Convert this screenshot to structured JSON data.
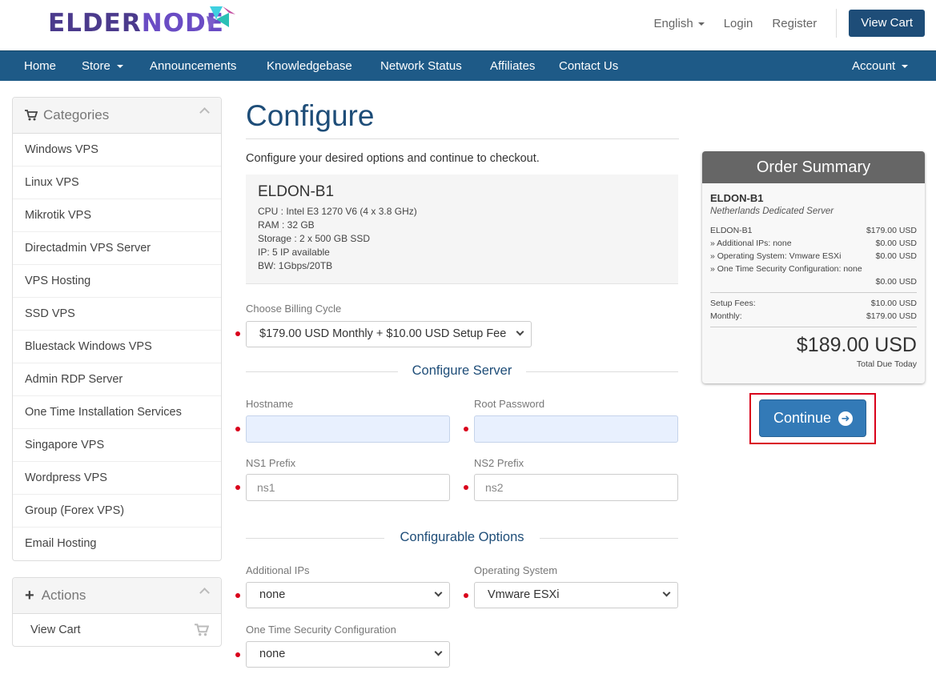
{
  "brand": {
    "logo_text_a": "ELDER",
    "logo_text_b": "NODE"
  },
  "header": {
    "language": "English",
    "login": "Login",
    "register": "Register",
    "view_cart": "View Cart"
  },
  "nav": {
    "home": "Home",
    "store": "Store",
    "announcements": "Announcements",
    "knowledgebase": "Knowledgebase",
    "network_status": "Network Status",
    "affiliates": "Affiliates",
    "contact_us": "Contact Us",
    "account": "Account"
  },
  "sidebar": {
    "categories_title": "Categories",
    "categories": [
      "Windows VPS",
      "Linux VPS",
      "Mikrotik VPS",
      "Directadmin VPS Server",
      "VPS Hosting",
      "SSD VPS",
      "Bluestack Windows VPS",
      "Admin RDP Server",
      "One Time Installation Services",
      "Singapore VPS",
      "Wordpress VPS",
      "Group (Forex VPS)",
      "Email Hosting"
    ],
    "actions_title": "Actions",
    "actions": [
      "View Cart"
    ]
  },
  "main": {
    "title": "Configure",
    "intro": "Configure your desired options and continue to checkout.",
    "product": {
      "name": "ELDON-B1",
      "lines": [
        "CPU : Intel E3 1270 V6 (4 x 3.8 GHz)",
        "RAM : 32 GB",
        "Storage : 2 x 500 GB SSD",
        "IP: 5 IP available",
        "BW: 1Gbps/20TB"
      ]
    },
    "billing_cycle_label": "Choose Billing Cycle",
    "billing_cycle_value": "$179.00 USD Monthly + $10.00 USD Setup Fee",
    "configure_server_heading": "Configure Server",
    "hostname_label": "Hostname",
    "hostname_value": "",
    "root_password_label": "Root Password",
    "root_password_value": "",
    "ns1_label": "NS1 Prefix",
    "ns1_placeholder": "ns1",
    "ns2_label": "NS2 Prefix",
    "ns2_placeholder": "ns2",
    "configurable_options_heading": "Configurable Options",
    "additional_ips_label": "Additional IPs",
    "additional_ips_value": "none",
    "operating_system_label": "Operating System",
    "operating_system_value": "Vmware ESXi",
    "security_config_label": "One Time Security Configuration",
    "security_config_value": "none"
  },
  "summary": {
    "title": "Order Summary",
    "product_name": "ELDON-B1",
    "product_group": "Netherlands Dedicated Server",
    "base_label": "ELDON-B1",
    "base_price": "$179.00 USD",
    "addl_ips_label": "» Additional IPs: none",
    "addl_ips_price": "$0.00 USD",
    "os_label": "» Operating System: Vmware ESXi",
    "os_price": "$0.00 USD",
    "security_label": "» One Time Security Configuration: none",
    "security_price": "$0.00 USD",
    "setup_fees_label": "Setup Fees:",
    "setup_fees_value": "$10.00 USD",
    "monthly_label": "Monthly:",
    "monthly_value": "$179.00 USD",
    "total": "$189.00 USD",
    "total_caption": "Total Due Today",
    "continue_label": "Continue"
  },
  "colors": {
    "nav_bg": "#1e5a87",
    "brand_dark": "#1e4d78",
    "primary_button": "#337ab7",
    "required_dot": "#d9001b",
    "highlight_frame": "#d9001b"
  }
}
